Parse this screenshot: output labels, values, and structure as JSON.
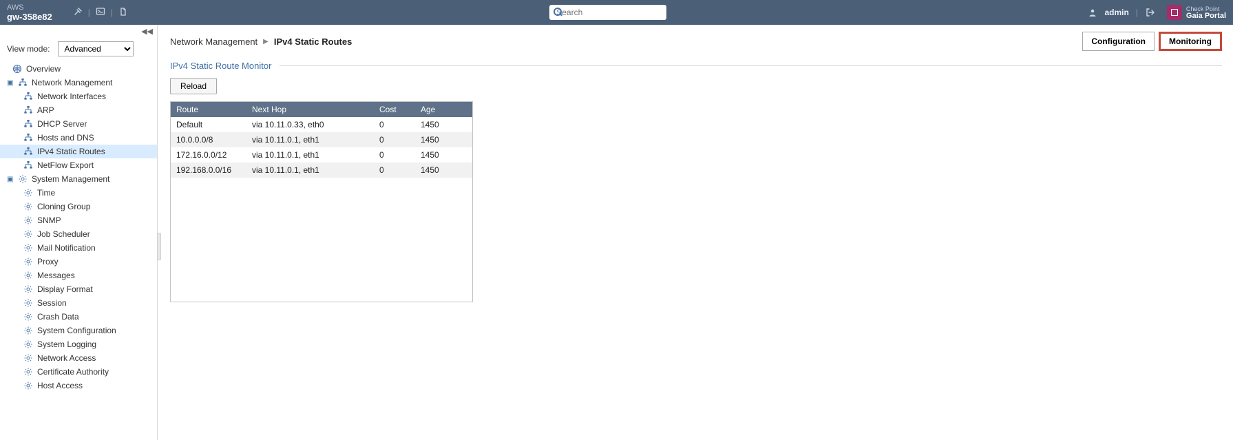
{
  "topbar": {
    "env": "AWS",
    "host": "gw-358e82",
    "search_placeholder": "Search",
    "user": "admin",
    "brand_line1": "Check Point",
    "brand_line2": "Gaia Portal"
  },
  "sidebar": {
    "collapse_glyph": "◀◀",
    "view_mode_label": "View mode:",
    "view_mode_value": "Advanced",
    "overview_label": "Overview",
    "groups": [
      {
        "id": "network-management",
        "label": "Network Management",
        "icon": "net",
        "children": [
          {
            "id": "network-interfaces",
            "label": "Network Interfaces",
            "icon": "net"
          },
          {
            "id": "arp",
            "label": "ARP",
            "icon": "net"
          },
          {
            "id": "dhcp-server",
            "label": "DHCP Server",
            "icon": "net"
          },
          {
            "id": "hosts-and-dns",
            "label": "Hosts and DNS",
            "icon": "net"
          },
          {
            "id": "ipv4-static-routes",
            "label": "IPv4 Static Routes",
            "icon": "net",
            "active": true
          },
          {
            "id": "netflow-export",
            "label": "NetFlow Export",
            "icon": "net"
          }
        ]
      },
      {
        "id": "system-management",
        "label": "System Management",
        "icon": "gear",
        "children": [
          {
            "id": "time",
            "label": "Time",
            "icon": "gear"
          },
          {
            "id": "cloning-group",
            "label": "Cloning Group",
            "icon": "gear"
          },
          {
            "id": "snmp",
            "label": "SNMP",
            "icon": "gear"
          },
          {
            "id": "job-scheduler",
            "label": "Job Scheduler",
            "icon": "gear"
          },
          {
            "id": "mail-notification",
            "label": "Mail Notification",
            "icon": "gear"
          },
          {
            "id": "proxy",
            "label": "Proxy",
            "icon": "gear"
          },
          {
            "id": "messages",
            "label": "Messages",
            "icon": "gear"
          },
          {
            "id": "display-format",
            "label": "Display Format",
            "icon": "gear"
          },
          {
            "id": "session",
            "label": "Session",
            "icon": "gear"
          },
          {
            "id": "crash-data",
            "label": "Crash Data",
            "icon": "gear"
          },
          {
            "id": "system-configuration",
            "label": "System Configuration",
            "icon": "gear"
          },
          {
            "id": "system-logging",
            "label": "System Logging",
            "icon": "gear"
          },
          {
            "id": "network-access",
            "label": "Network Access",
            "icon": "gear"
          },
          {
            "id": "certificate-authority",
            "label": "Certificate Authority",
            "icon": "gear"
          },
          {
            "id": "host-access",
            "label": "Host Access",
            "icon": "gear"
          }
        ]
      }
    ]
  },
  "breadcrumb": {
    "parent": "Network Management",
    "current": "IPv4 Static Routes"
  },
  "tabs": {
    "configuration": "Configuration",
    "monitoring": "Monitoring"
  },
  "section_title": "IPv4 Static Route Monitor",
  "reload_label": "Reload",
  "route_table": {
    "columns": [
      "Route",
      "Next Hop",
      "Cost",
      "Age"
    ],
    "rows": [
      {
        "route": "Default",
        "next_hop": "via 10.11.0.33, eth0",
        "cost": "0",
        "age": "1450"
      },
      {
        "route": "10.0.0.0/8",
        "next_hop": "via 10.11.0.1, eth1",
        "cost": "0",
        "age": "1450"
      },
      {
        "route": "172.16.0.0/12",
        "next_hop": "via 10.11.0.1, eth1",
        "cost": "0",
        "age": "1450"
      },
      {
        "route": "192.168.0.0/16",
        "next_hop": "via 10.11.0.1, eth1",
        "cost": "0",
        "age": "1450"
      }
    ]
  }
}
